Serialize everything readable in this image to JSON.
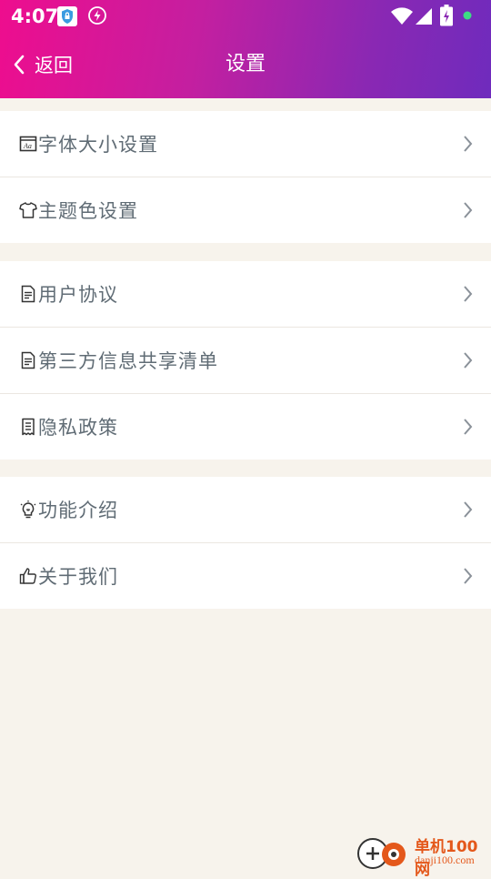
{
  "status_bar": {
    "time": "4:07"
  },
  "nav": {
    "back_label": "返回",
    "title": "设置"
  },
  "groups": [
    {
      "items": [
        {
          "label": "字体大小设置",
          "icon": "font-size-icon"
        },
        {
          "label": "主题色设置",
          "icon": "shirt-icon"
        }
      ]
    },
    {
      "items": [
        {
          "label": "用户协议",
          "icon": "document-icon"
        },
        {
          "label": "第三方信息共享清单",
          "icon": "document-icon"
        },
        {
          "label": "隐私政策",
          "icon": "receipt-icon"
        }
      ]
    },
    {
      "items": [
        {
          "label": "功能介绍",
          "icon": "lightbulb-icon"
        },
        {
          "label": "关于我们",
          "icon": "thumbs-up-icon"
        }
      ]
    }
  ],
  "watermark": {
    "line1": "单机100网",
    "line2": "danji100.com"
  },
  "colors": {
    "header_start": "#ee0d8e",
    "header_end": "#6f2bbd",
    "background": "#f7f3ec",
    "label": "#606c75"
  }
}
